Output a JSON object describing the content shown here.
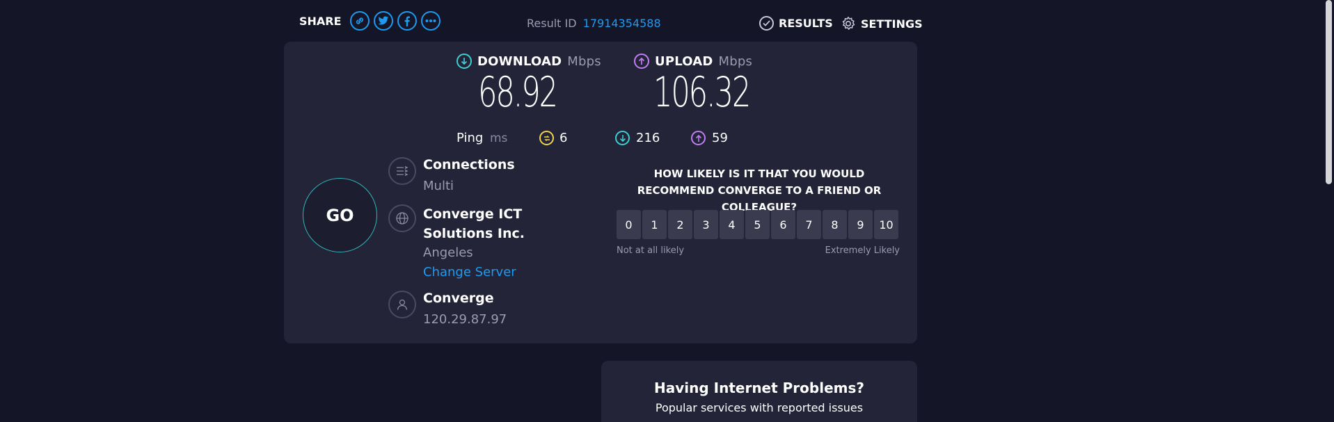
{
  "header": {
    "share_label": "SHARE",
    "result_id_label": "Result ID",
    "result_id_value": "17914354588",
    "results_label": "RESULTS",
    "settings_label": "SETTINGS"
  },
  "speeds": {
    "download_label": "DOWNLOAD",
    "download_unit": "Mbps",
    "download_value": "68.92",
    "upload_label": "UPLOAD",
    "upload_unit": "Mbps",
    "upload_value": "106.32"
  },
  "ping": {
    "label": "Ping",
    "unit": "ms",
    "idle": "6",
    "download": "216",
    "upload": "59"
  },
  "go_label": "GO",
  "connections": {
    "title": "Connections",
    "value": "Multi"
  },
  "server": {
    "title": "Converge ICT Solutions Inc.",
    "location": "Angeles",
    "change_link": "Change Server"
  },
  "isp": {
    "title": "Converge",
    "ip": "120.29.87.97"
  },
  "nps": {
    "question": "HOW LIKELY IS IT THAT YOU WOULD RECOMMEND CONVERGE TO A FRIEND OR COLLEAGUE?",
    "scale": [
      "0",
      "1",
      "2",
      "3",
      "4",
      "5",
      "6",
      "7",
      "8",
      "9",
      "10"
    ],
    "low_label": "Not at all likely",
    "high_label": "Extremely Likely"
  },
  "problems": {
    "title": "Having Internet Problems?",
    "subtitle": "Popular services with reported issues"
  },
  "colors": {
    "background": "#141526",
    "card": "#232437",
    "accent_blue": "#1d9bf0",
    "download": "#3ecfd0",
    "upload": "#c17ef5",
    "ping": "#f5d442"
  }
}
